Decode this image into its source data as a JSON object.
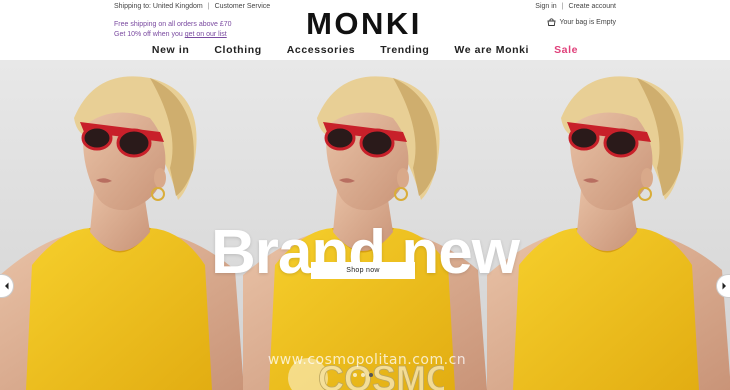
{
  "header": {
    "shipping_label": "Shipping to: United Kingdom",
    "customer_service_label": "Customer Service",
    "promo_line1": "Free shipping on all orders above £70",
    "promo_line2_prefix": "Get 10% off when you ",
    "promo_line2_link": "get on our list",
    "logo_text": "MONKI",
    "sign_in_label": "Sign in",
    "create_account_label": "Create account",
    "bag_label": "Your bag is Empty"
  },
  "nav": {
    "items": [
      {
        "label": "New in"
      },
      {
        "label": "Clothing"
      },
      {
        "label": "Accessories"
      },
      {
        "label": "Trending"
      },
      {
        "label": "We are Monki"
      },
      {
        "label": "Sale"
      }
    ]
  },
  "hero": {
    "headline": "Brand new",
    "cta_label": "Shop now",
    "slide_count": 3,
    "active_slide": 3
  },
  "watermark": {
    "logo_text": "COSMO",
    "url": "www.cosmopolitan.com.cn"
  },
  "colors": {
    "sale": "#e0407a",
    "promo": "#7a4aa0",
    "top_yellow": "#f2c21a",
    "sunglasses_frame": "#c8202a"
  },
  "icons": [
    "bag-icon",
    "chevron-left-icon",
    "chevron-right-icon"
  ]
}
